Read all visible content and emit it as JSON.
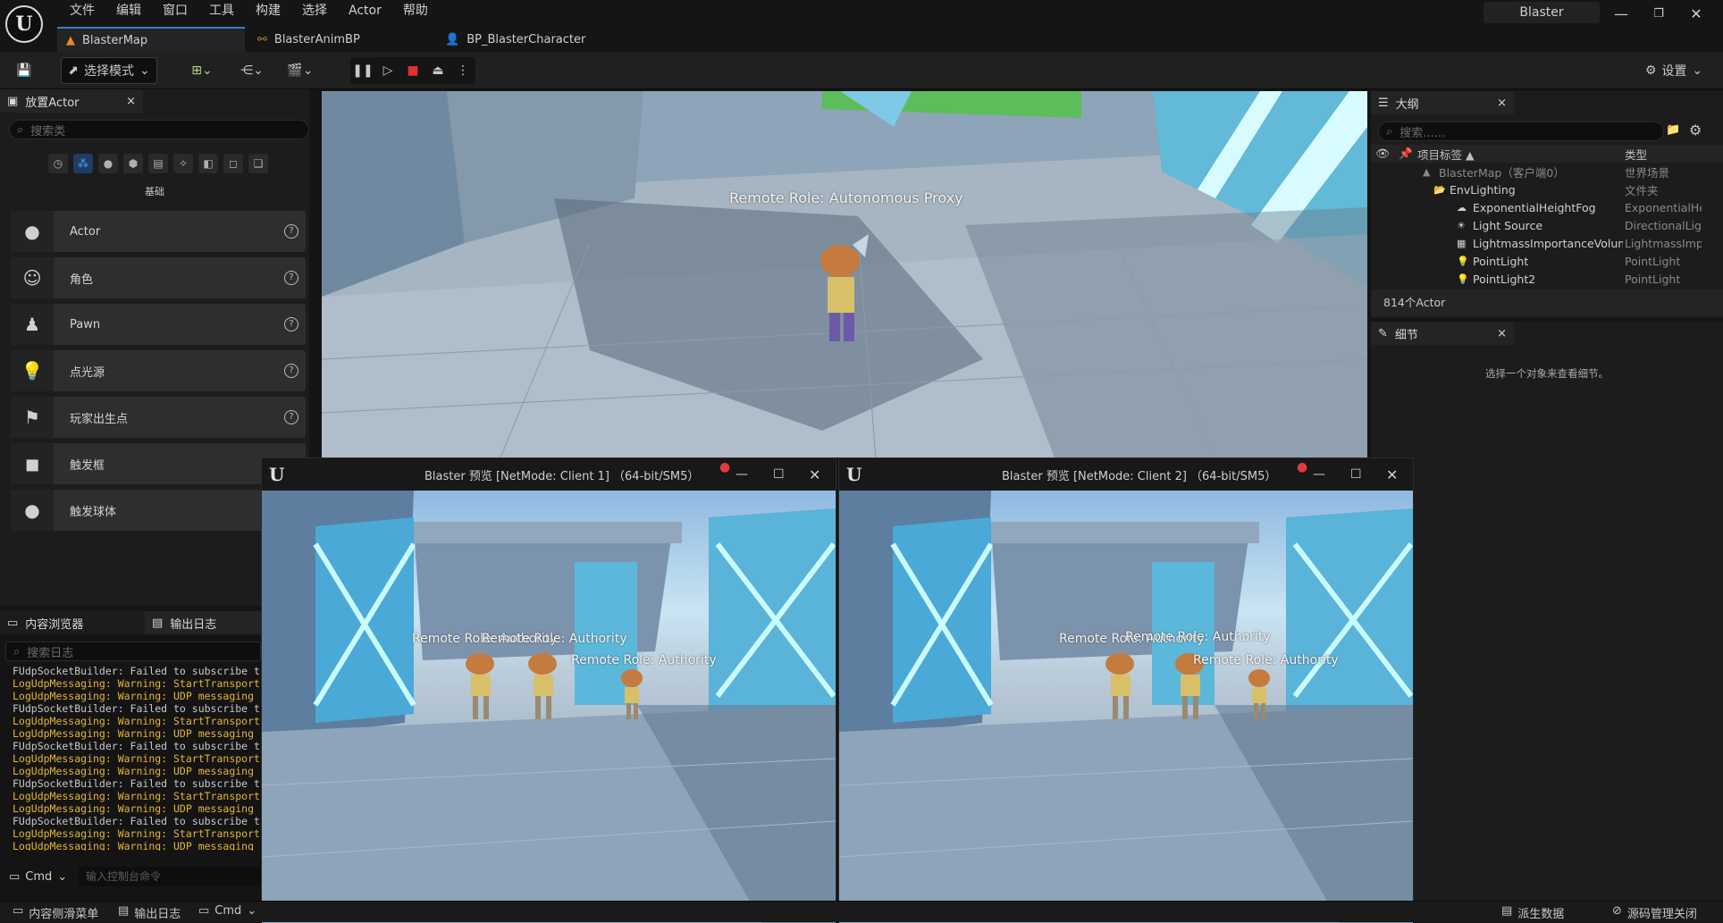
{
  "app": {
    "menu": [
      "文件",
      "编辑",
      "窗口",
      "工具",
      "构建",
      "选择",
      "Actor",
      "帮助"
    ],
    "project": "Blaster",
    "tabs": [
      {
        "label": "BlasterMap"
      },
      {
        "label": "BlasterAnimBP"
      },
      {
        "label": "BP_BlasterCharacter"
      }
    ]
  },
  "toolbar": {
    "mode": "选择模式",
    "settings": "设置"
  },
  "place_actor": {
    "tab": "放置Actor",
    "search_placeholder": "搜索类",
    "category": "基础",
    "items": [
      {
        "label": "Actor"
      },
      {
        "label": "角色"
      },
      {
        "label": "Pawn"
      },
      {
        "label": "点光源"
      },
      {
        "label": "玩家出生点"
      },
      {
        "label": "触发框"
      },
      {
        "label": "触发球体"
      }
    ]
  },
  "log": {
    "tabs": [
      "内容浏览器",
      "输出日志"
    ],
    "search_placeholder": "搜索日志",
    "lines": [
      {
        "text": "FUdpSocketBuilder: Failed to subscribe t",
        "color": "#c8c8c8"
      },
      {
        "text": "LogUdpMessaging: Warning: StartTransport",
        "color": "#e5b533"
      },
      {
        "text": "LogUdpMessaging: Warning: UDP messaging",
        "color": "#e5b533"
      },
      {
        "text": "FUdpSocketBuilder: Failed to subscribe t",
        "color": "#c8c8c8"
      },
      {
        "text": "LogUdpMessaging: Warning: StartTransport",
        "color": "#e5b533"
      },
      {
        "text": "LogUdpMessaging: Warning: UDP messaging",
        "color": "#e5b533"
      },
      {
        "text": "FUdpSocketBuilder: Failed to subscribe t",
        "color": "#c8c8c8"
      },
      {
        "text": "LogUdpMessaging: Warning: StartTransport",
        "color": "#e5b533"
      },
      {
        "text": "LogUdpMessaging: Warning: UDP messaging",
        "color": "#e5b533"
      },
      {
        "text": "FUdpSocketBuilder: Failed to subscribe t",
        "color": "#c8c8c8"
      },
      {
        "text": "LogUdpMessaging: Warning: StartTransport",
        "color": "#e5b533"
      },
      {
        "text": "LogUdpMessaging: Warning: UDP messaging",
        "color": "#e5b533"
      },
      {
        "text": "FUdpSocketBuilder: Failed to subscribe t",
        "color": "#c8c8c8"
      },
      {
        "text": "LogUdpMessaging: Warning: StartTransport",
        "color": "#e5b533"
      },
      {
        "text": "LogUdpMessaging: Warning: UDP messaging",
        "color": "#e5b533"
      }
    ],
    "cmd": "Cmd",
    "cmd_placeholder": "输入控制台命令"
  },
  "viewport": {
    "label": "Remote Role: Autonomous Proxy"
  },
  "outliner": {
    "tab": "大纲",
    "search_placeholder": "搜索......",
    "col_label": "项目标签 ▲",
    "col_type": "类型",
    "rows": [
      {
        "label": "BlasterMap（客户端0）",
        "type": "世界场景"
      },
      {
        "label": "EnvLighting",
        "type": "文件夹"
      },
      {
        "label": "ExponentialHeightFog",
        "type": "ExponentialHe"
      },
      {
        "label": "Light Source",
        "type": "DirectionalLigl"
      },
      {
        "label": "LightmassImportanceVolum",
        "type": "LightmassImp"
      },
      {
        "label": "PointLight",
        "type": "PointLight"
      },
      {
        "label": "PointLight2",
        "type": "PointLight"
      }
    ],
    "count": "814个Actor"
  },
  "details": {
    "tab": "细节",
    "empty": "选择一个对象来查看细节。"
  },
  "preview": [
    {
      "title": "Blaster 预览 [NetMode: Client 1]  （64-bit/SM5）",
      "roles": [
        "Remote Role: Authority",
        "Remote Role: Authority",
        "Remote Role: Authority"
      ]
    },
    {
      "title": "Blaster 预览 [NetMode: Client 2]  （64-bit/SM5）",
      "roles": [
        "Remote Role: Authority",
        "Remote Role: Authority",
        "Remote Role: Authority"
      ]
    }
  ],
  "bottom": {
    "drawer": "内容侧滑菜单",
    "output": "输出日志",
    "cmd": "Cmd",
    "derived": "派生数据",
    "source": "源码管理关闭"
  }
}
